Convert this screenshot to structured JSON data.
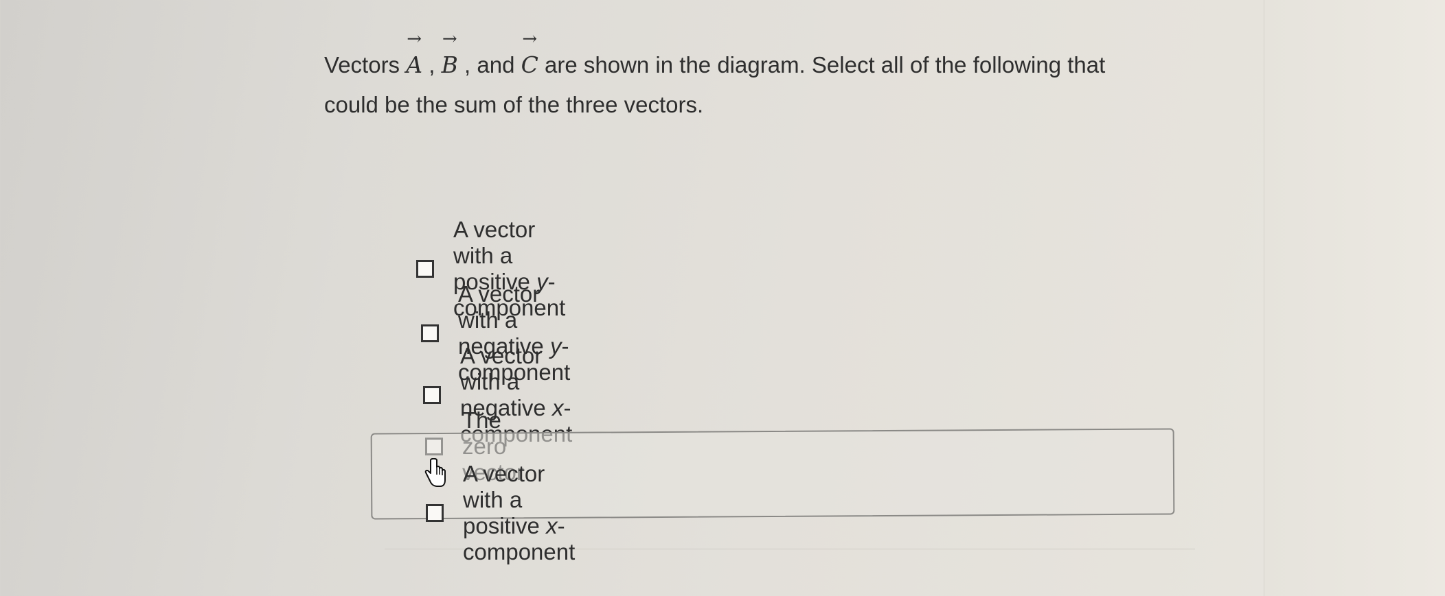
{
  "question": {
    "prefix": "Vectors ",
    "vector_a": "A",
    "sep1": " , ",
    "vector_b": "B",
    "sep2": " , and ",
    "vector_c": "C",
    "line1_rest": " are shown in the diagram. Select all of the following that",
    "line2": "could be the sum of the three vectors.",
    "arrow_glyph": "→"
  },
  "options": [
    {
      "pre": "A vector with a positive ",
      "var": "y",
      "post": "-component",
      "checked": false
    },
    {
      "pre": "A vector with a negative ",
      "var": "y",
      "post": "-component",
      "checked": false
    },
    {
      "pre": "A vector with a negative ",
      "var": "x",
      "post": "-component",
      "checked": false
    },
    {
      "pre": "The zero vector",
      "var": "",
      "post": "",
      "checked": false
    },
    {
      "pre": "A vector with a positive ",
      "var": "x",
      "post": "-component",
      "checked": false,
      "hovered": true
    }
  ],
  "icons": {
    "cursor": "hand-pointer-icon",
    "checkbox": "checkbox-icon"
  }
}
